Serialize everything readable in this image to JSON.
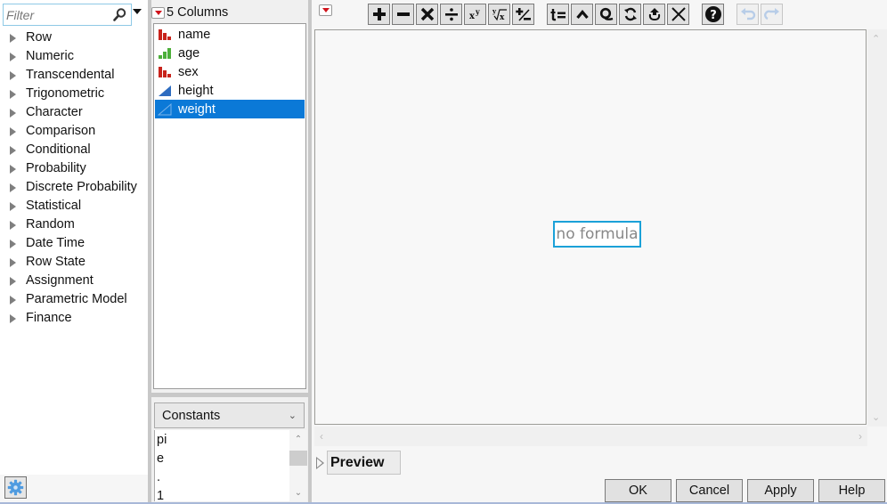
{
  "left_pane": {
    "filter": {
      "placeholder": "Filter",
      "value": ""
    },
    "categories": [
      {
        "label": "Row"
      },
      {
        "label": "Numeric"
      },
      {
        "label": "Transcendental"
      },
      {
        "label": "Trigonometric"
      },
      {
        "label": "Character"
      },
      {
        "label": "Comparison"
      },
      {
        "label": "Conditional"
      },
      {
        "label": "Probability"
      },
      {
        "label": "Discrete Probability"
      },
      {
        "label": "Statistical"
      },
      {
        "label": "Random"
      },
      {
        "label": "Date Time"
      },
      {
        "label": "Row State"
      },
      {
        "label": "Assignment"
      },
      {
        "label": "Parametric Model"
      },
      {
        "label": "Finance"
      }
    ]
  },
  "columns_pane": {
    "title": "5 Columns",
    "columns": [
      {
        "label": "name",
        "type_icon": "nominal-icon",
        "selected": false
      },
      {
        "label": "age",
        "type_icon": "ordinal-icon",
        "selected": false
      },
      {
        "label": "sex",
        "type_icon": "nominal-icon",
        "selected": false
      },
      {
        "label": "height",
        "type_icon": "continuous-icon",
        "selected": false
      },
      {
        "label": "weight",
        "type_icon": "continuous-icon",
        "selected": true
      }
    ],
    "constants_select": "Constants",
    "constants": [
      {
        "label": "pi"
      },
      {
        "label": "e"
      },
      {
        "label": "."
      },
      {
        "label": "1"
      }
    ]
  },
  "editor": {
    "toolbar": [
      {
        "name": "add-button",
        "icon": "plus-icon"
      },
      {
        "name": "subtract-button",
        "icon": "minus-icon"
      },
      {
        "name": "multiply-button",
        "icon": "times-icon"
      },
      {
        "name": "divide-button",
        "icon": "divide-icon"
      },
      {
        "name": "power-button",
        "icon": "power-icon"
      },
      {
        "name": "root-button",
        "icon": "root-icon"
      },
      {
        "name": "negate-button",
        "icon": "plus-minus-icon"
      },
      {
        "name": "local-variable-button",
        "icon": "t-equals-icon"
      },
      {
        "name": "peel-button",
        "icon": "caret-up-icon"
      },
      {
        "name": "lasso-button",
        "icon": "lasso-icon"
      },
      {
        "name": "swap-button",
        "icon": "swap-icon"
      },
      {
        "name": "unary-button",
        "icon": "unary-up-icon"
      },
      {
        "name": "delete-button",
        "icon": "delete-x-icon"
      },
      {
        "name": "help-button",
        "icon": "help-icon"
      },
      {
        "name": "undo-button",
        "icon": "undo-icon",
        "disabled": true
      },
      {
        "name": "redo-button",
        "icon": "redo-icon",
        "disabled": true
      }
    ],
    "formula_placeholder": "no formula",
    "preview_label": "Preview"
  },
  "dialog_buttons": {
    "ok": "OK",
    "cancel": "Cancel",
    "apply": "Apply",
    "help": "Help"
  },
  "colors": {
    "selection": "#0b79d7",
    "focus_border": "#1ba1d8",
    "nominal_icon": "#c8231b",
    "ordinal_icon": "#4caf3a",
    "continuous_icon": "#2d6cc0"
  }
}
